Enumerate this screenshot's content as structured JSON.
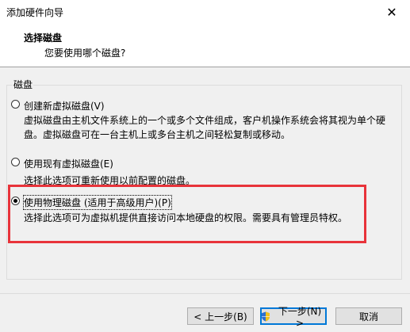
{
  "window": {
    "title": "添加硬件向导",
    "close_glyph": "✕"
  },
  "header": {
    "title": "选择磁盘",
    "subtitle": "您要使用哪个磁盘?"
  },
  "group": {
    "label": "磁盘"
  },
  "options": [
    {
      "label": "创建新虚拟磁盘(V)",
      "description": "虚拟磁盘由主机文件系统上的一个或多个文件组成，客户机操作系统会将其视为单个硬盘。虚拟磁盘可在一台主机上或多台主机之间轻松复制或移动。",
      "checked": false
    },
    {
      "label": "使用现有虚拟磁盘(E)",
      "description": "选择此选项可重新使用以前配置的磁盘。",
      "checked": false
    },
    {
      "label": "使用物理磁盘 (适用于高级用户)(P)",
      "description": "选择此选项可为虚拟机提供直接访问本地硬盘的权限。需要具有管理员特权。",
      "checked": true
    }
  ],
  "buttons": {
    "back": "< 上一步(B)",
    "next": "下一步(N) >",
    "cancel": "取消"
  },
  "colors": {
    "highlight_border": "#e8333a",
    "primary_button_border": "#0078d7"
  },
  "icons": {
    "next_button_icon": "uac-shield-icon"
  }
}
